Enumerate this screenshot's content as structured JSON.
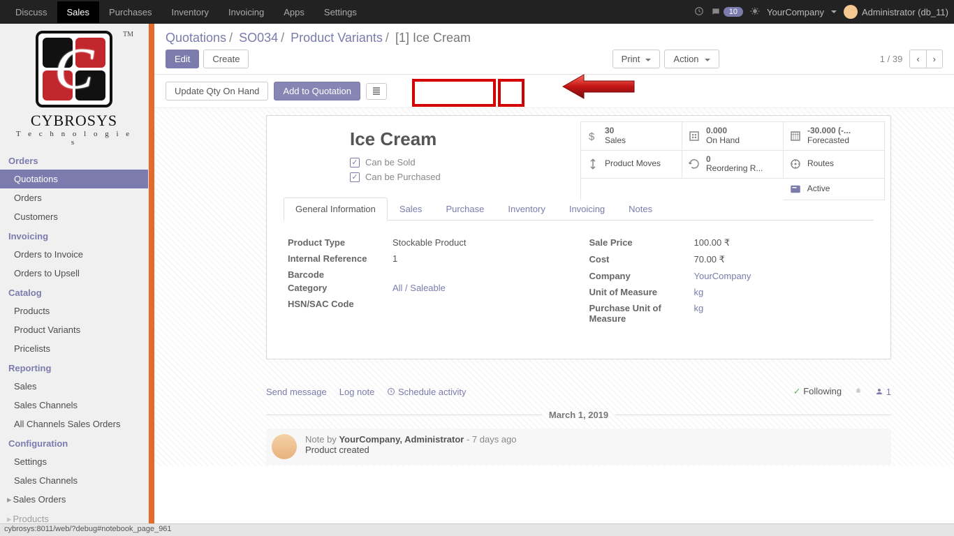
{
  "topbar": {
    "menu": [
      "Discuss",
      "Sales",
      "Purchases",
      "Inventory",
      "Invoicing",
      "Apps",
      "Settings"
    ],
    "active_index": 1,
    "msg_count": "10",
    "company": "YourCompany",
    "user": "Administrator (db_11)"
  },
  "logo": {
    "name": "CYBROSYS",
    "sub": "T e c h n o l o g i e s",
    "tm": "TM"
  },
  "sidebar": {
    "sections": [
      {
        "header": "Orders",
        "items": [
          {
            "label": "Quotations",
            "active": true
          },
          {
            "label": "Orders"
          },
          {
            "label": "Customers"
          }
        ]
      },
      {
        "header": "Invoicing",
        "items": [
          {
            "label": "Orders to Invoice"
          },
          {
            "label": "Orders to Upsell"
          }
        ]
      },
      {
        "header": "Catalog",
        "items": [
          {
            "label": "Products"
          },
          {
            "label": "Product Variants"
          },
          {
            "label": "Pricelists"
          }
        ]
      },
      {
        "header": "Reporting",
        "items": [
          {
            "label": "Sales"
          },
          {
            "label": "Sales Channels"
          },
          {
            "label": "All Channels Sales Orders"
          }
        ]
      },
      {
        "header": "Configuration",
        "items": [
          {
            "label": "Settings"
          },
          {
            "label": "Sales Channels"
          },
          {
            "label": "Sales Orders",
            "caret": true
          },
          {
            "label": "Products",
            "caret": true,
            "cut": true
          }
        ]
      }
    ]
  },
  "breadcrumb": {
    "parts": [
      "Quotations",
      "SO034",
      "Product Variants",
      "[1] Ice Cream"
    ]
  },
  "btns": {
    "edit": "Edit",
    "create": "Create",
    "print": "Print",
    "action": "Action",
    "update_qty": "Update Qty On Hand",
    "add_quot": "Add to Quotation"
  },
  "pager": {
    "pos": "1 / 39"
  },
  "stats": {
    "sales": {
      "num": "30",
      "lbl": "Sales"
    },
    "on_hand": {
      "num": "0.000",
      "lbl": "On Hand"
    },
    "forecast": {
      "num": "-30.000 (-...",
      "lbl": "Forecasted"
    },
    "moves": {
      "lbl": "Product Moves"
    },
    "reorder": {
      "num": "0",
      "lbl": "Reordering R..."
    },
    "routes": {
      "lbl": "Routes"
    },
    "active": {
      "lbl": "Active"
    }
  },
  "product": {
    "title": "Ice Cream",
    "can_be_sold": "Can be Sold",
    "can_be_purchased": "Can be Purchased"
  },
  "tabs": [
    "General Information",
    "Sales",
    "Purchase",
    "Inventory",
    "Invoicing",
    "Notes"
  ],
  "active_tab": 0,
  "gen": {
    "product_type_l": "Product Type",
    "product_type": "Stockable Product",
    "internal_ref_l": "Internal Reference",
    "internal_ref": "1",
    "barcode_l": "Barcode",
    "barcode": "",
    "category_l": "Category",
    "category": "All / Saleable",
    "hsn_l": "HSN/SAC Code",
    "hsn": "",
    "sale_price_l": "Sale Price",
    "sale_price": "100.00 ₹",
    "cost_l": "Cost",
    "cost": "70.00 ₹",
    "company_l": "Company",
    "company": "YourCompany",
    "uom_l": "Unit of Measure",
    "uom": "kg",
    "puom_l": "Purchase Unit of Measure",
    "puom": "kg"
  },
  "chat": {
    "send": "Send message",
    "log": "Log note",
    "sched": "Schedule activity",
    "following": "Following",
    "follower_count": "1",
    "date": "March 1, 2019",
    "note_by_label": "Note by",
    "author": "YourCompany, Administrator",
    "age": "- 7 days ago",
    "body": "Product created"
  },
  "statusbar": "cybrosys:8011/web/?debug#notebook_page_961"
}
